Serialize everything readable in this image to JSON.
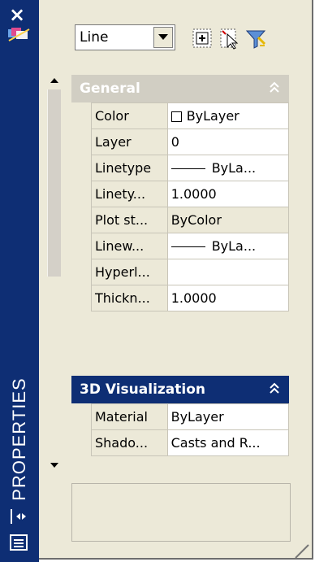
{
  "palette": {
    "title": "PROPERTIES",
    "close_icon": "×"
  },
  "toolbar": {
    "object_type": "Line",
    "buttons": [
      "toggle-pickadd-icon",
      "select-objects-icon",
      "quick-select-icon"
    ]
  },
  "sections": {
    "general": {
      "title": "General",
      "rows": [
        {
          "name": "Color",
          "value": "ByLayer"
        },
        {
          "name": "Layer",
          "value": "0"
        },
        {
          "name": "Linetype",
          "value": "ByLa..."
        },
        {
          "name": "Linety...",
          "value": "1.0000"
        },
        {
          "name": "Plot st...",
          "value": "ByColor"
        },
        {
          "name": "Linew...",
          "value": "ByLa..."
        },
        {
          "name": "Hyperl...",
          "value": ""
        },
        {
          "name": "Thickn...",
          "value": "1.0000"
        }
      ]
    },
    "visualization": {
      "title": "3D Visualization",
      "rows": [
        {
          "name": "Material",
          "value": "ByLayer"
        },
        {
          "name": "Shado...",
          "value": "Casts and R..."
        }
      ]
    }
  },
  "colors": {
    "sidebar": "#0e2e74",
    "panel": "#ece9d8",
    "general_header": "#d1cec3",
    "viz_header": "#0e2e74"
  }
}
